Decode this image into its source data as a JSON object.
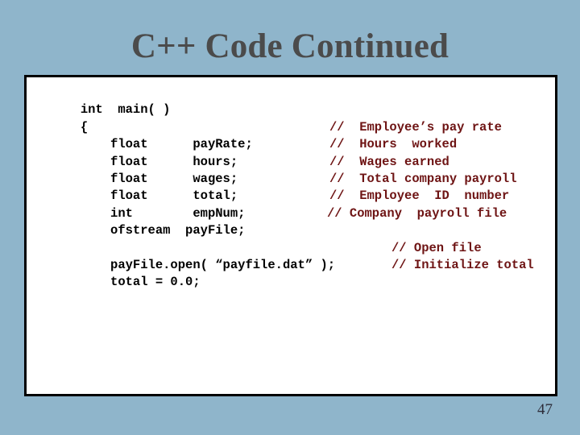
{
  "slide": {
    "title": "C++ Code Continued",
    "page_number": "47",
    "background_color": "#8fb5cb",
    "title_color": "#4b4b4b",
    "code_color": "#000000",
    "comment_color": "#6e1414",
    "panel_background": "#ffffff",
    "panel_border_color": "#000000"
  },
  "code_block": {
    "lines": [
      {
        "code": "int  main( )",
        "comment": ""
      },
      {
        "code": "{",
        "comment": ""
      },
      {
        "code": "    float      payRate;",
        "comment": "//  Employee’s pay rate"
      },
      {
        "code": "    float      hours;",
        "comment": "//  Hours  worked"
      },
      {
        "code": "    float      wages;",
        "comment": "//  Wages earned"
      },
      {
        "code": "    float      total;",
        "comment": "//  Total company payroll"
      },
      {
        "code": "    int        empNum;",
        "comment": "//  Employee  ID  number"
      },
      {
        "code": "    ofstream  payFile;",
        "comment": "// Company  payroll file"
      },
      {
        "code": "",
        "comment": ""
      },
      {
        "code": "    payFile.open( “payfile.dat” );",
        "comment": "// Open file"
      },
      {
        "code": "    total = 0.0;",
        "comment": "// Initialize total"
      }
    ]
  }
}
